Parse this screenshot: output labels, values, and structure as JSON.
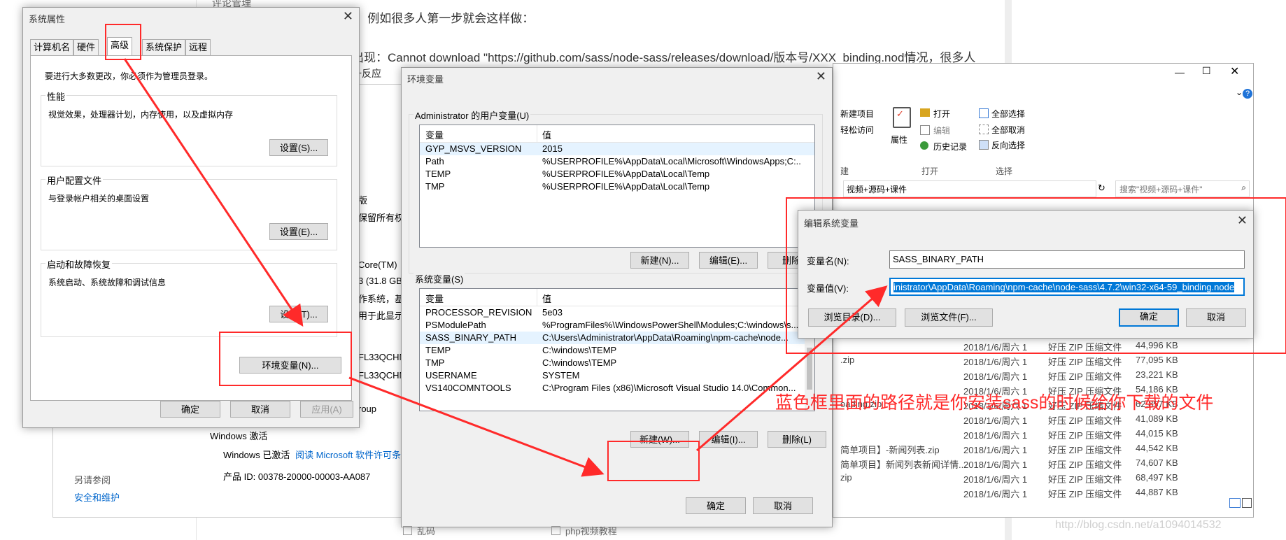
{
  "article": {
    "line1": "①：例如很多人第一步就会这样做：",
    "line2": "出现：Cannot download \"https://github.com/sass/node-sass/releases/download/版本号/XXX_binding.nod情况，很多人",
    "line3": "一反应",
    "top_label": "评论管理"
  },
  "sysinfo": {
    "edition_label": "版",
    "rights": "保留所有权利",
    "cpu": "Core(TM)",
    "ram": "3 (31.8 GB",
    "os_type": "作系统，基",
    "pen": "用于此显示器",
    "pcname1": "FL33QCHN",
    "pcname2": "FL33QCHN",
    "workgroup": "roup",
    "activation_title": "Windows 激活",
    "activated": "Windows 已激活",
    "license_link": "阅读 Microsoft 软件许可条款",
    "product_id": "产品 ID: 00378-20000-00003-AA087",
    "see_also": "另请参阅",
    "security": "安全和维护"
  },
  "sys_props": {
    "title": "系统属性",
    "tabs": [
      "计算机名",
      "硬件",
      "高级",
      "系统保护",
      "远程"
    ],
    "admin_note": "要进行大多数更改，你必须作为管理员登录。",
    "perf_label": "性能",
    "perf_desc": "视觉效果，处理器计划，内存使用，以及虚拟内存",
    "perf_btn": "设置(S)...",
    "profile_label": "用户配置文件",
    "profile_desc": "与登录帐户相关的桌面设置",
    "profile_btn": "设置(E)...",
    "startup_label": "启动和故障恢复",
    "startup_desc": "系统启动、系统故障和调试信息",
    "startup_btn": "设置(T)...",
    "env_btn": "环境变量(N)...",
    "ok": "确定",
    "cancel": "取消",
    "apply": "应用(A)"
  },
  "env_vars": {
    "title": "环境变量",
    "user_group": "Administrator 的用户变量(U)",
    "col_var": "变量",
    "col_val": "值",
    "user_rows": [
      {
        "name": "GYP_MSVS_VERSION",
        "value": "2015"
      },
      {
        "name": "Path",
        "value": "%USERPROFILE%\\AppData\\Local\\Microsoft\\WindowsApps;C:..."
      },
      {
        "name": "TEMP",
        "value": "%USERPROFILE%\\AppData\\Local\\Temp"
      },
      {
        "name": "TMP",
        "value": "%USERPROFILE%\\AppData\\Local\\Temp"
      }
    ],
    "user_new": "新建(N)...",
    "user_edit": "编辑(E)...",
    "user_delete": "删除(D",
    "sys_group": "系统变量(S)",
    "sys_rows": [
      {
        "name": "PROCESSOR_REVISION",
        "value": "5e03"
      },
      {
        "name": "PSModulePath",
        "value": "%ProgramFiles%\\WindowsPowerShell\\Modules;C:\\windows\\s..."
      },
      {
        "name": "SASS_BINARY_PATH",
        "value": "C:\\Users\\Administrator\\AppData\\Roaming\\npm-cache\\node..."
      },
      {
        "name": "TEMP",
        "value": "C:\\windows\\TEMP"
      },
      {
        "name": "TMP",
        "value": "C:\\windows\\TEMP"
      },
      {
        "name": "USERNAME",
        "value": "SYSTEM"
      },
      {
        "name": "VS140COMNTOOLS",
        "value": "C:\\Program Files (x86)\\Microsoft Visual Studio 14.0\\Common..."
      }
    ],
    "sys_new": "新建(W)...",
    "sys_edit": "编辑(I)...",
    "sys_delete": "删除(L)",
    "ok": "确定",
    "cancel": "取消"
  },
  "edit_var": {
    "title": "编辑系统变量",
    "name_label": "变量名(N):",
    "name_value": "SASS_BINARY_PATH",
    "value_label": "变量值(V):",
    "value_value": "inistrator\\AppData\\Roaming\\npm-cache\\node-sass\\4.7.2\\win32-x64-59_binding.node",
    "browse_dir": "浏览目录(D)...",
    "browse_file": "浏览文件(F)...",
    "ok": "确定",
    "cancel": "取消"
  },
  "explorer": {
    "new_item": "新建项目",
    "easy_access": "轻松访问",
    "properties": "属性",
    "open": "打开",
    "edit": "编辑",
    "history": "历史记录",
    "select_all": "全部选择",
    "select_none": "全部取消",
    "invert": "反向选择",
    "group_new": "建",
    "group_open": "打开",
    "group_select": "选择",
    "breadcrumb": "视频+源码+课件",
    "search_placeholder": "搜索\"视频+源码+课件\"",
    "rows": [
      {
        "name": "",
        "date": "2018/1/6/周六 1",
        "type": "好压 ZIP 压缩文件",
        "size": "44,996 KB"
      },
      {
        "name": ".zip",
        "date": "2018/1/6/周六 1",
        "type": "好压 ZIP 压缩文件",
        "size": "77,095 KB"
      },
      {
        "name": "",
        "date": "2018/1/6/周六 1",
        "type": "好压 ZIP 压缩文件",
        "size": "23,221 KB"
      },
      {
        "name": "",
        "date": "2018/1/6/周六 1",
        "type": "好压 ZIP 压缩文件",
        "size": "54,186 KB"
      },
      {
        "name": "oading.zip",
        "date": "2018/1/6/周六 1",
        "type": "好压 ZIP 压缩文件",
        "size": "62,857 KB"
      },
      {
        "name": "",
        "date": "2018/1/6/周六 1",
        "type": "好压 ZIP 压缩文件",
        "size": "41,089 KB"
      },
      {
        "name": "",
        "date": "2018/1/6/周六 1",
        "type": "好压 ZIP 压缩文件",
        "size": "44,015 KB"
      },
      {
        "name": "简单项目】-新闻列表.zip",
        "date": "2018/1/6/周六 1",
        "type": "好压 ZIP 压缩文件",
        "size": "44,542 KB"
      },
      {
        "name": "简单项目】新闻列表新闻详情...",
        "date": "2018/1/6/周六 1",
        "type": "好压 ZIP 压缩文件",
        "size": "74,607 KB"
      },
      {
        "name": "zip",
        "date": "2018/1/6/周六 1",
        "type": "好压 ZIP 压缩文件",
        "size": "68,497 KB"
      },
      {
        "name": "",
        "date": "2018/1/6/周六 1",
        "type": "好压 ZIP 压缩文件",
        "size": "44,887 KB"
      }
    ]
  },
  "annotation": "蓝色框里面的路径就是你安装sass的时候给你下载的文件",
  "footer": {
    "item1": "乱码",
    "item2": "php视频教程",
    "watermark": "http://blog.csdn.net/a1094014532"
  },
  "colors": {
    "annotation": "#ff2a2a",
    "selection": "#0078d7"
  }
}
